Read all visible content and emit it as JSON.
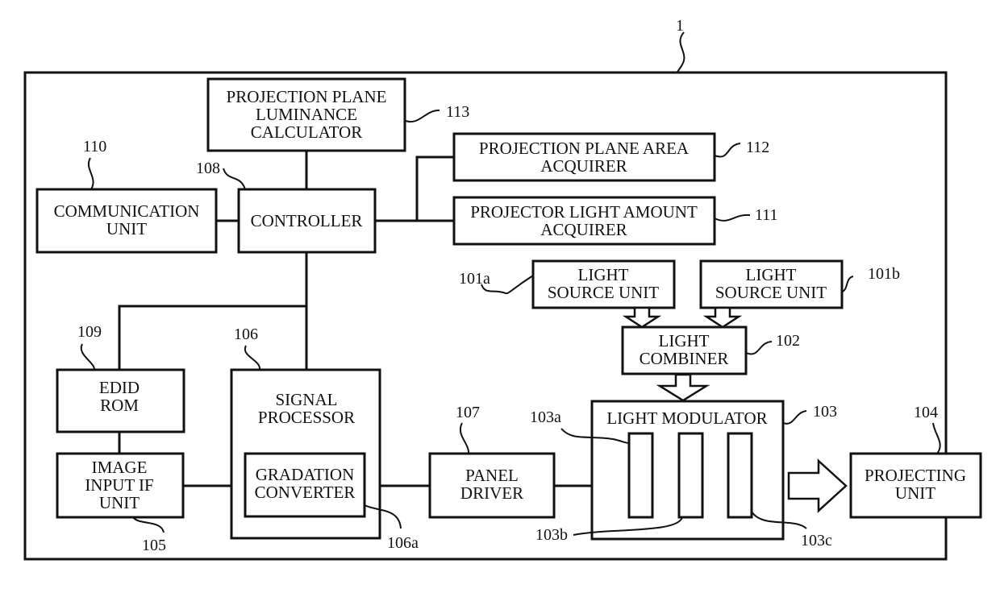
{
  "figure": {
    "system_ref": "1",
    "blocks": {
      "luminance_calculator": {
        "lines": [
          "PROJECTION PLANE",
          "LUMINANCE",
          "CALCULATOR"
        ],
        "ref": "113"
      },
      "area_acquirer": {
        "lines": [
          "PROJECTION PLANE AREA",
          "ACQUIRER"
        ],
        "ref": "112"
      },
      "light_amount_acquirer": {
        "lines": [
          "PROJECTOR LIGHT AMOUNT",
          "ACQUIRER"
        ],
        "ref": "111"
      },
      "communication_unit": {
        "lines": [
          "COMMUNICATION",
          "UNIT"
        ],
        "ref": "110"
      },
      "controller": {
        "lines": [
          "CONTROLLER"
        ],
        "ref": "108"
      },
      "light_source_a": {
        "lines": [
          "LIGHT",
          "SOURCE UNIT"
        ],
        "ref": "101a"
      },
      "light_source_b": {
        "lines": [
          "LIGHT",
          "SOURCE UNIT"
        ],
        "ref": "101b"
      },
      "light_combiner": {
        "lines": [
          "LIGHT",
          "COMBINER"
        ],
        "ref": "102"
      },
      "edid_rom": {
        "lines": [
          "EDID",
          "ROM"
        ],
        "ref": "109"
      },
      "signal_processor": {
        "lines": [
          "SIGNAL",
          "PROCESSOR"
        ],
        "ref": "106"
      },
      "gradation_converter": {
        "lines": [
          "GRADATION",
          "CONVERTER"
        ],
        "ref": "106a"
      },
      "image_input_if": {
        "lines": [
          "IMAGE",
          "INPUT IF",
          "UNIT"
        ],
        "ref": "105"
      },
      "panel_driver": {
        "lines": [
          "PANEL",
          "DRIVER"
        ],
        "ref": "107"
      },
      "light_modulator": {
        "lines": [
          "LIGHT MODULATOR"
        ],
        "ref": "103",
        "panel_refs": [
          "103a",
          "103b",
          "103c"
        ]
      },
      "projecting_unit": {
        "lines": [
          "PROJECTING",
          "UNIT"
        ],
        "ref": "104"
      }
    }
  }
}
